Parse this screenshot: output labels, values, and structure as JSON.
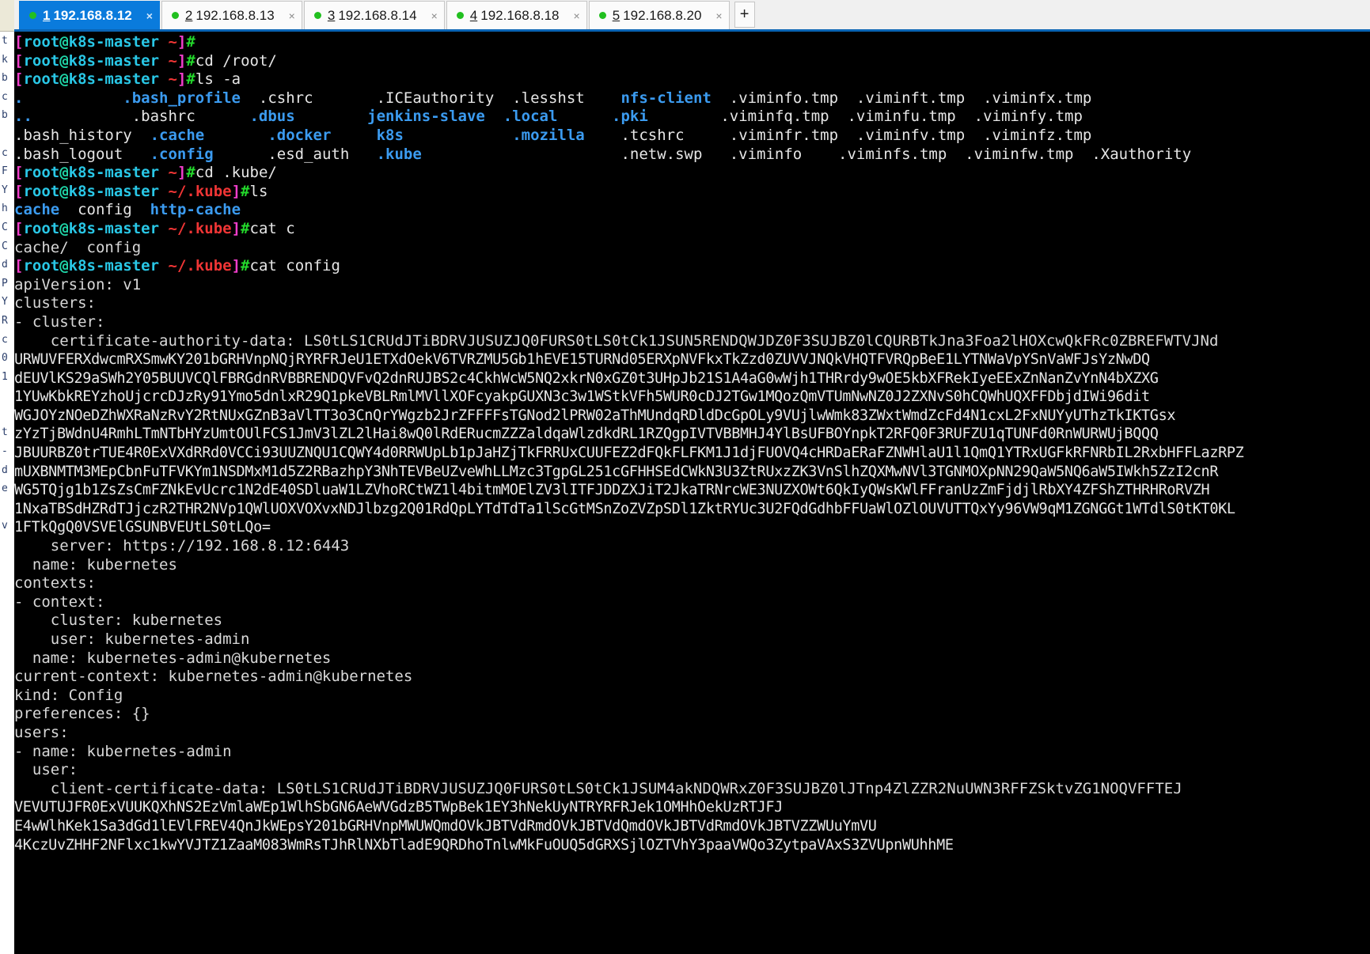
{
  "window": {
    "title": "192.168.8.12",
    "accent_color": "#0a7bdc",
    "tabbar_rule_color": "#0a64b4",
    "terminal_bg": "#000000",
    "terminal_fg": "#e6e6e6"
  },
  "tabbar": {
    "new_tab_label": "+",
    "close_glyph": "×",
    "status_dot_color": "#22c020",
    "tabs": [
      {
        "num": "1",
        "label": "192.168.8.12",
        "active": true
      },
      {
        "num": "2",
        "label": "192.168.8.13",
        "active": false
      },
      {
        "num": "3",
        "label": "192.168.8.14",
        "active": false
      },
      {
        "num": "4",
        "label": "192.168.8.18",
        "active": false
      },
      {
        "num": "5",
        "label": "192.168.8.20",
        "active": false
      }
    ]
  },
  "prompt": {
    "user": "root",
    "host": "k8s-master",
    "cwd_home": "~",
    "cwd_kube": "~/.kube",
    "sigil": "#",
    "colors": {
      "bracket": "#f23ecb",
      "user": "#29c7e6",
      "at": "#1fd6a8",
      "host": "#29c7e6",
      "path": "#f03535",
      "sigil": "#23d92b"
    }
  },
  "session": {
    "commands": [
      "",
      "cd /root/",
      "ls -a",
      "cd .kube/",
      "ls",
      "cat c",
      "cat config"
    ],
    "ls_root_rows": [
      [
        ".",
        ".bash_profile",
        ".cshrc",
        ".ICEauthority",
        ".lesshst",
        "nfs-client",
        ".viminfo.tmp",
        ".viminft.tmp",
        ".viminfx.tmp"
      ],
      [
        "..",
        ".bashrc",
        ".dbus",
        "jenkins-slave",
        ".local",
        ".pki",
        ".viminfq.tmp",
        ".viminfu.tmp",
        ".viminfy.tmp"
      ],
      [
        ".bash_history",
        ".cache",
        ".docker",
        "k8s",
        ".mozilla",
        ".tcshrc",
        ".viminfr.tmp",
        ".viminfv.tmp",
        ".viminfz.tmp"
      ],
      [
        ".bash_logout",
        ".config",
        ".esd_auth",
        ".kube",
        "",
        ".netw.swp",
        ".viminfo",
        ".viminfs.tmp",
        ".viminfw.tmp",
        ".Xauthority"
      ]
    ],
    "ls_root_dirs": [
      ".bash_profile",
      ".dbus",
      "jenkins-slave",
      "nfs-client",
      ".bashrc",
      ".cache",
      ".docker",
      "k8s",
      ".local",
      ".pki",
      ".config",
      ".kube",
      ".mozilla",
      "..",
      "."
    ],
    "ls_kube_entries": [
      "cache",
      "config",
      "http-cache"
    ],
    "ls_kube_dirs": [
      "cache",
      "http-cache"
    ],
    "completion_line": "cache/  config"
  },
  "kubeconfig": {
    "api_version_line": "apiVersion: v1",
    "clusters_key": "clusters:",
    "cluster_item": "- cluster:",
    "ca_data_label": "    certificate-authority-data: ",
    "ca_data_head": "LS0tLS1CRUdJTiBDRVJUSUZJQ0FURS0tLS0tCk1JSUN5RENDQWJDZ0F3SUJBZ0lCQURBTkJna3Foa2lHOXcwQkFRc0ZBREFWTVJNd",
    "ca_data_lines": [
      "URWUVFERXdwcmRXSmwKY201bGRHVnpNQjRYRFRJeU1ETXdOekV6TVRZMU5Gb1hEVE15TURNd05ERXpNVFkxTkZzd0ZUVVJNQkVHQTFVRQpBeE1LYTNWaVpYSnVaWFJsYzNwDQ",
      "dEUVlKS29aSWh2Y05BUUVCQlFBRGdnRVBBRENDQVFvQ2dnRUJBS2c4CkhWcW5NQ2xkrN0xGZ0t3UHpJb21S1A4aG0wWjh1THRrdy9wOE5kbXFRekIyeEExZnNanZvYnN4bXZXG",
      "1YUwKbkREYzhoUjcrcDJzRy91Ymo5dnlxR29Q1pkeVBLRmlMVllXOFcyakpGUXN3c3w1WStkVFh5WUR0cDJ2TGw1MQozQmVTUmNwNZ0J2ZXNvS0hCQWhUQXFFDbjdIWi96dit",
      "WGJOYzNOeDZhWXRaNzRvY2RtNUxGZnB3aVlTT3o3CnQrYWgzb2JrZFFFFsTGNod2lPRW02aThMUndqRDldDcGpOLy9VUjlwWmk83ZWxtWmdZcFd4N1cxL2FxNUYyUThzTkIKTGsx",
      "zYzTjBWdnU4RmhLTmNTbHYzUmtOUlFCS1JmV3lZL2lHai8wQ0lRdERucmZZZaldqaWlzdkdRL1RZQgpIVTVBBMHJ4YlBsUFBOYnpkT2RFQ0F3RUFZU1qTUNFd0RnWURWUjBQQQ",
      "JBUURBZ0trTUE4R0ExVXdRRd0VCCi93UUZNQU1CQWY4d0RRWUpLb1pJaHZjTkFRRUxCUUFEZ2dFQkFLFKM1J1djFUOVQ4cHRDaERaFZNWHlaU1l1QmQ1YTRxUGFkRFNRbIL2RxbHFFLazRPZ",
      "mUXBNMTM3MEpCbnFuTFVKYm1NSDMxM1d5Z2RBazhpY3NhTEVBeUZveWhLLMzc3TgpGL251cGFHHSEdCWkN3U3ZtRUxzZK3VnSlhZQXMwNVl3TGNMOXpNN29QaW5NQ6aW5IWkh5ZzI2cnR",
      "WG5TQjg1b1ZsZsCmFZNkEvUcrc1N2dE40SDluaW1LZVhoRCtWZ1l4bitmMOElZV3lITFJDDZXJiT2JkaTRNrcWE3NUZXOWt6QkIyQWsKWlFFranUzZmFjdjlRbXY4ZFShZTHRHRoRVZH",
      "1NxaTBSdHZRdTJjczR2THR2NVp1QWlUOXVOXvxNDJlbzg2Q01RdQpLYTdTdTa1lScGtMSnZoZVZpSDl1ZktRYUc3U2FQdGdhbFFUaWlOZlOUVUTTQxYy96VW9qM1ZGNGGt1WTdlS0tKT0KL",
      "1FTkQgQ0VSVElGSUNBVEUtLS0tLQo="
    ],
    "server_line": "    server: https://192.168.8.12:6443",
    "cluster_name_line": "  name: kubernetes",
    "contexts_key": "contexts:",
    "context_item": "- context:",
    "context_cluster": "    cluster: kubernetes",
    "context_user": "    user: kubernetes-admin",
    "context_name": "  name: kubernetes-admin@kubernetes",
    "current_context": "current-context: kubernetes-admin@kubernetes",
    "kind_line": "kind: Config",
    "preferences_line": "preferences: {}",
    "users_key": "users:",
    "user_name_line": "- name: kubernetes-admin",
    "user_key": "  user:",
    "client_cert_label": "    client-certificate-data: ",
    "client_cert_head": "LS0tLS1CRUdJTiBDRVJUSUZJQ0FURS0tLS0tCk1JSUM4akNDQWRxZ0F3SUJBZ0lJTnp4ZlZZR2NuUWN3RFFZSktvZG1NOQVFFTEJ",
    "client_cert_lines": [
      "VEVUTUJFR0ExVUUKQXhNS2EzVmlaWEp1WlhSbGN6AeWVGdzB5TWpBek1EY3hNekUyNTRYRFRJek1OMHhOekUzRTJFJ",
      "E4wWlhKek1Sa3dGd1lEVlFREV4QnJkWEpsY201bGRHVnpMWUWQmdOVkJBTVdRmdOVkJBTVdQmdOVkJBTVdRmdOVkJBTVZZWUuYmVU",
      "4KczUvZHHF2NFlxc1kwYVJTZ1ZaaM083WmRsTJhRlNXbTladE9QRDhoTnlwMkFuOUQ5dGRXSjlOZTVhY3paaVWQo3ZytpaVAxS3ZVUpnWUhhME"
    ]
  }
}
